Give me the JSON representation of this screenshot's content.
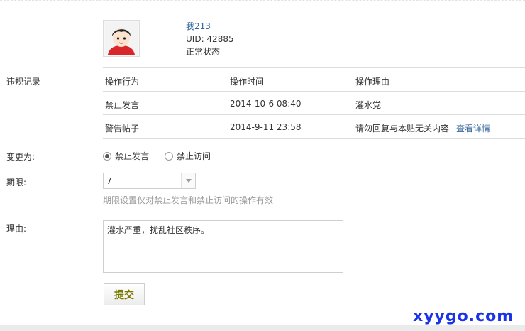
{
  "user": {
    "name": "我213",
    "uid": "UID: 42885",
    "status": "正常状态"
  },
  "labels": {
    "records": "违规记录",
    "change_to": "变更为:",
    "duration": "期限:",
    "reason": "理由:"
  },
  "records_table": {
    "headers": [
      "操作行为",
      "操作时间",
      "操作理由"
    ],
    "rows": [
      {
        "action": "禁止发言",
        "time": "2014-10-6 08:40",
        "reason": "灌水党",
        "link": ""
      },
      {
        "action": "警告帖子",
        "time": "2014-9-11 23:58",
        "reason": "请勿回复与本贴无关内容",
        "link": "查看详情"
      }
    ]
  },
  "change_options": {
    "selected": "禁止发言",
    "options": [
      "禁止发言",
      "禁止访问"
    ]
  },
  "duration": {
    "value": "7",
    "hint": "期限设置仅对禁止发言和禁止访问的操作有效"
  },
  "reason_text": "灌水严重，扰乱社区秩序。",
  "submit_label": "提交",
  "watermark": "xyygo.com",
  "colors": {
    "link": "#336699",
    "border": "#dcdcdc",
    "hint": "#999999",
    "submit_text": "#7a7a00",
    "watermark": "#1a33e6"
  },
  "icons": {
    "avatar": "user-avatar-cartoon",
    "select_arrow": "chevron-down-icon"
  }
}
